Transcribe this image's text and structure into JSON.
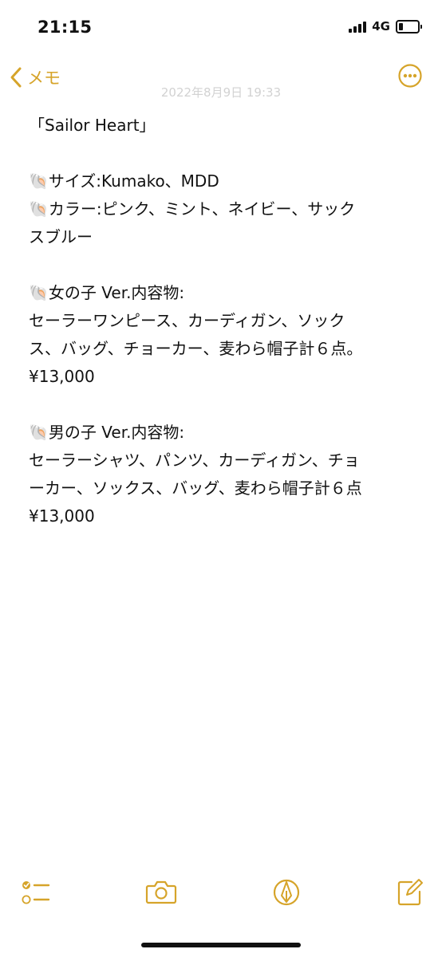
{
  "status_bar": {
    "time": "21:15",
    "network": "4G"
  },
  "nav": {
    "back_label": "メモ",
    "date": "2022年8月9日 19:33"
  },
  "note": {
    "lines": [
      "「Sailor Heart」",
      "",
      "🐚サイズ:Kumako、MDD",
      "🐚カラー:ピンク、ミント、ネイビー、サック",
      "スブルー",
      "",
      "🐚女の子 Ver.内容物:",
      "セーラーワンピース、カーディガン、ソック",
      "ス、バッグ、チョーカー、麦わら帽子計６点。",
      "¥13,000",
      "",
      "🐚男の子 Ver.内容物:",
      "セーラーシャツ、パンツ、カーディガン、チョ",
      "ーカー、ソックス、バッグ、麦わら帽子計６点",
      "¥13,000"
    ]
  },
  "toolbar": {
    "items": [
      "checklist-icon",
      "camera-icon",
      "markup-icon",
      "compose-icon"
    ]
  },
  "colors": {
    "accent": "#D6A42A",
    "text": "#111111",
    "background": "#FFFFFF"
  }
}
